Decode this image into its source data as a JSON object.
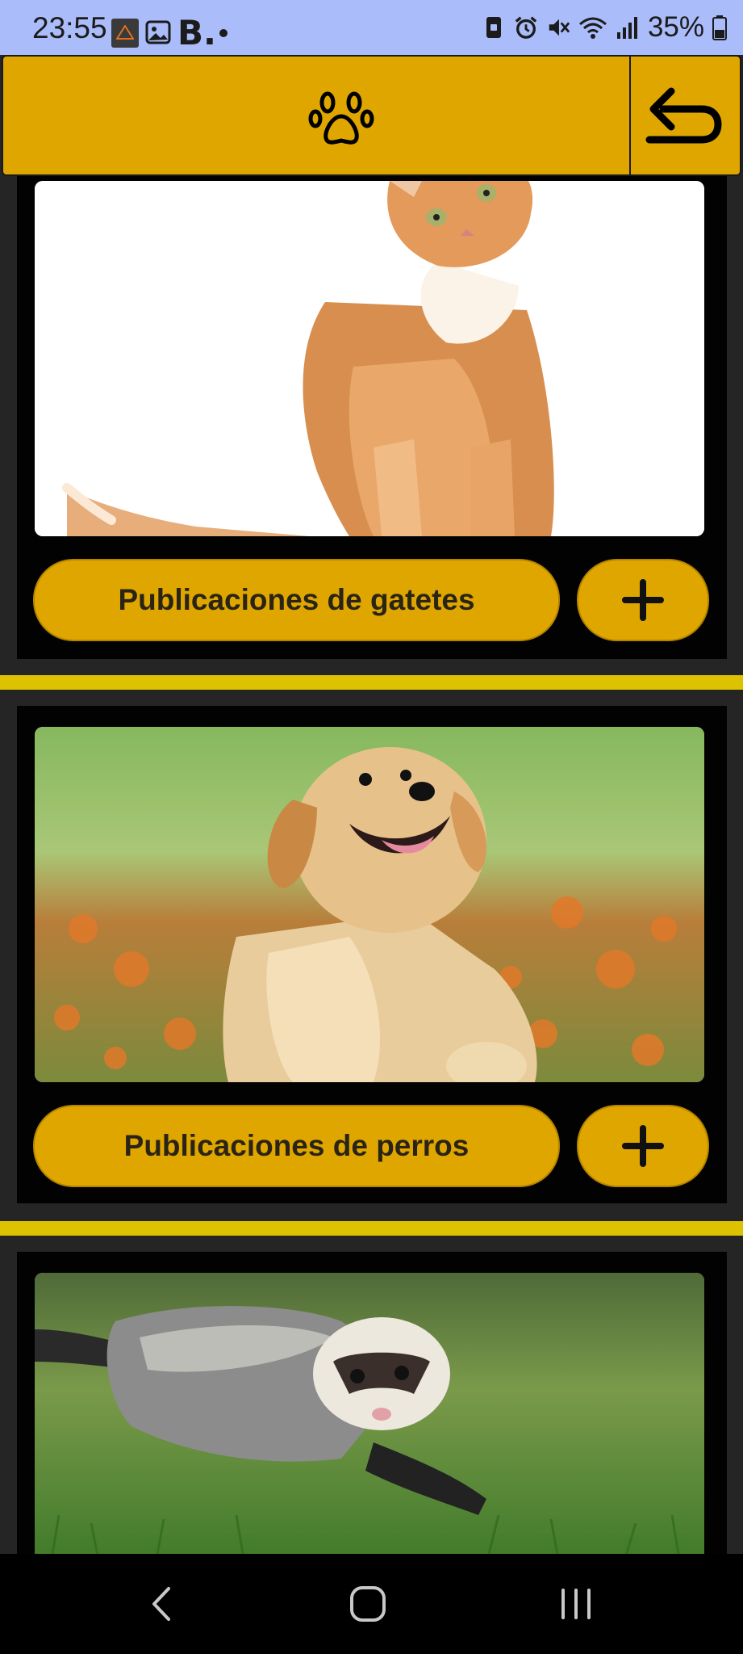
{
  "status_bar": {
    "time": "23:55",
    "b_label": "B.",
    "battery_text": "35%",
    "icons": [
      "app-icon",
      "gallery-icon",
      "b-app-icon",
      "notification-dot",
      "vibrate-lock-icon",
      "alarm-icon",
      "mute-icon",
      "wifi-icon",
      "signal-icon",
      "battery-icon"
    ]
  },
  "header": {
    "logo_icon": "paw-icon",
    "back_icon": "back-arrow-icon",
    "background": "#e0a600"
  },
  "cards": [
    {
      "image": "orange cat photo",
      "button_label": "Publicaciones de gatetes",
      "add_icon": "plus-icon"
    },
    {
      "image": "golden retriever puppy photo",
      "button_label": "Publicaciones de perros",
      "add_icon": "plus-icon"
    },
    {
      "image": "ferret photo"
    }
  ],
  "nav_bar": {
    "items": [
      "back-icon",
      "home-icon",
      "recents-icon"
    ]
  },
  "colors": {
    "accent": "#e0a600",
    "stripe": "#dcc200",
    "page": "#252525",
    "card": "#020202",
    "status_bar": "#aabcf9"
  }
}
